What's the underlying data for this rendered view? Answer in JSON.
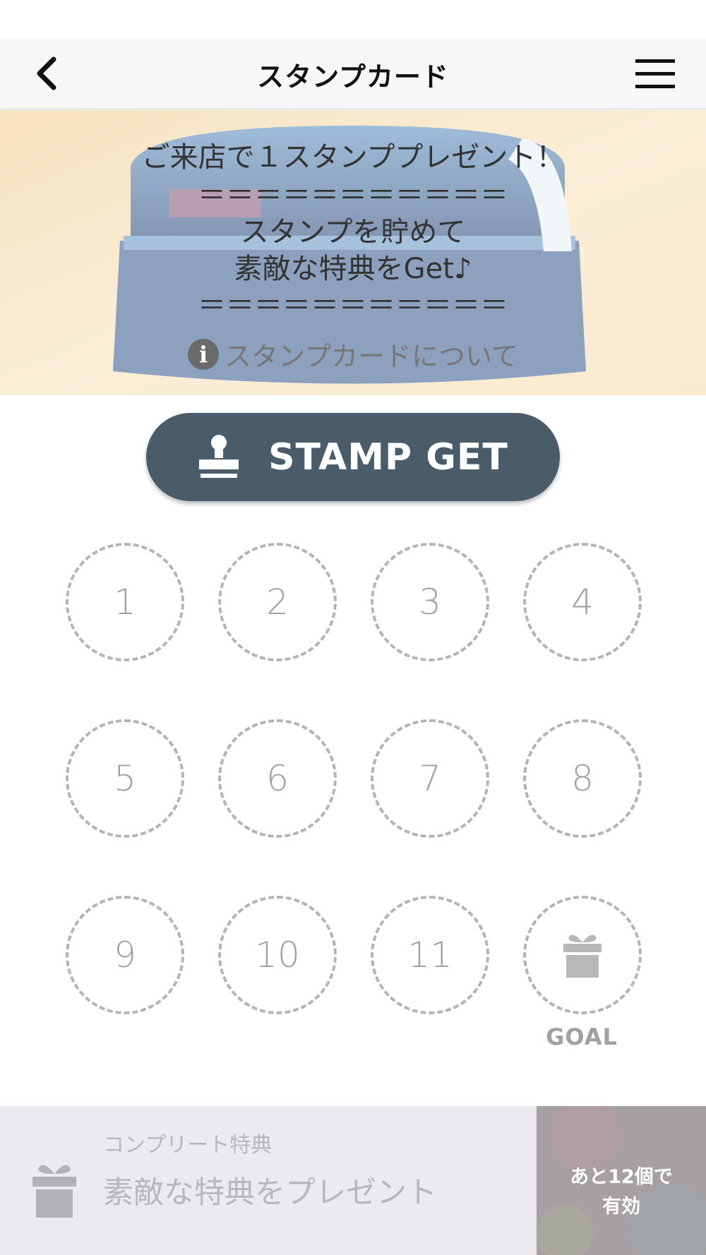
{
  "navbar": {
    "title": "スタンプカード",
    "back_icon": "chevron-left-icon",
    "menu_icon": "hamburger-menu-icon"
  },
  "hero": {
    "lines": [
      "ご来店で１スタンププレゼント！",
      "＝＝＝＝＝＝＝＝＝＝＝",
      "スタンプを貯めて",
      "素敵な特典をGet♪",
      "＝＝＝＝＝＝＝＝＝＝＝"
    ],
    "info_link": "スタンプカードについて",
    "info_icon": "info-icon"
  },
  "stamp_button": {
    "label": "STAMP GET",
    "icon": "stamp-icon"
  },
  "stamps": {
    "slots": [
      "1",
      "2",
      "3",
      "4",
      "5",
      "6",
      "7",
      "8",
      "9",
      "10",
      "11"
    ],
    "goal_label": "GOAL",
    "goal_icon": "gift-icon",
    "collected": 0
  },
  "complete_reward": {
    "title": "コンプリート特典",
    "reward": "素敵な特典をプレゼント",
    "remaining_line1": "あと12個で",
    "remaining_line2": "有効",
    "icon": "gift-icon"
  },
  "colors": {
    "button": "#4a5b6a",
    "stamp_border": "#b4b4b4",
    "navbar_bg": "#f7f7f7"
  }
}
